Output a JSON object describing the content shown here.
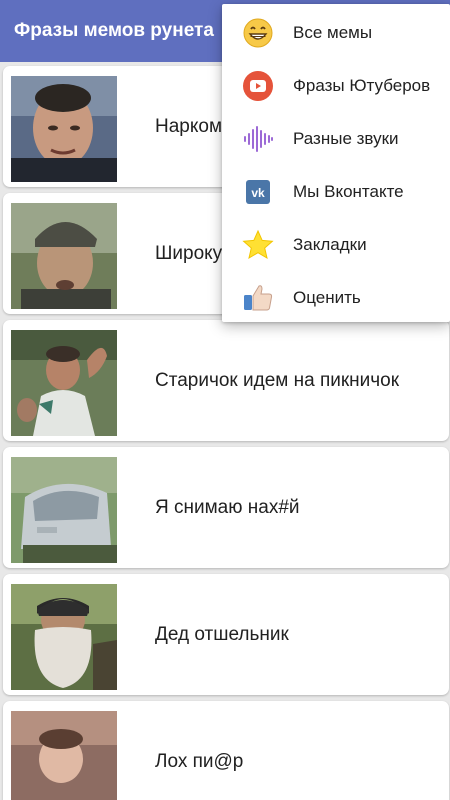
{
  "app_bar": {
    "title": "Фразы мемов рунета"
  },
  "colors": {
    "app_bar": "#5f6fbf",
    "card": "#ffffff",
    "background": "#e8e8e8",
    "menu": "#ffffff"
  },
  "memes": [
    {
      "label": "Наркоман Сергей",
      "thumbnail_icon": "man-face-photo"
    },
    {
      "label": "Широкую на широкую",
      "thumbnail_icon": "old-man-cap-photo"
    },
    {
      "label": "Старичок идем на пикничок",
      "thumbnail_icon": "man-outdoors-photo"
    },
    {
      "label": "Я снимаю нах#й",
      "thumbnail_icon": "car-photo"
    },
    {
      "label": "Дед отшельник",
      "thumbnail_icon": "bearded-old-man-photo"
    },
    {
      "label": "Лох пи@р",
      "thumbnail_icon": "boy-photo"
    }
  ],
  "menu": {
    "items": [
      {
        "label": "Все мемы",
        "icon": "grinning-face-icon"
      },
      {
        "label": "Фразы Ютуберов",
        "icon": "youtube-icon"
      },
      {
        "label": "Разные звуки",
        "icon": "sound-wave-icon"
      },
      {
        "label": "Мы Вконтакте",
        "icon": "vk-icon"
      },
      {
        "label": "Закладки",
        "icon": "star-icon"
      },
      {
        "label": "Оценить",
        "icon": "thumbs-up-icon"
      }
    ]
  }
}
